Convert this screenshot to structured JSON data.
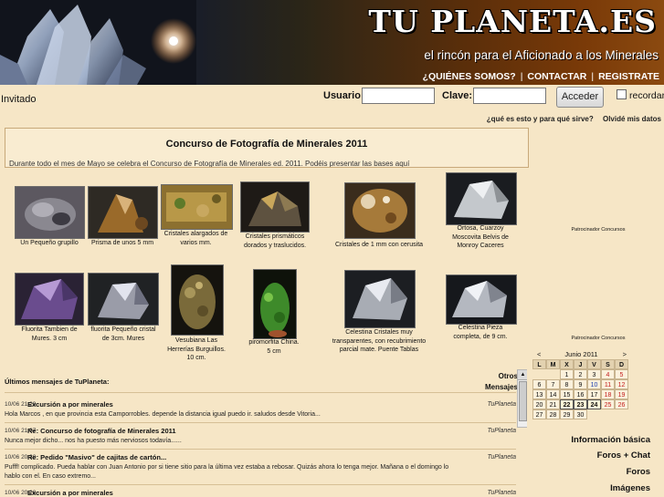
{
  "header": {
    "site_title": "TU PLANETA.ES",
    "tagline": "el rincón para el Aficionado a los Minerales",
    "links": [
      "¿QUIÉNES SOMOS?",
      "CONTACTAR",
      "REGISTRATE"
    ]
  },
  "login": {
    "guest_label": "Invitado",
    "user_label": "Usuario:",
    "pass_label": "Clave:",
    "submit_label": "Acceder",
    "remember_label": "recordar",
    "help_link": "¿qué es esto y para qué sirve?",
    "forgot_link": "Olvidé mis datos"
  },
  "contest": {
    "title": "Concurso de Fotografía de Minerales 2011",
    "text": "Durante todo el mes de Mayo se celebra el Concurso de Fotografía de Minerales ed. 2011. Podéis presentar las bases aquí"
  },
  "gallery": {
    "row1": [
      {
        "caption": "Un Pequeño grupillo"
      },
      {
        "caption": "Prisma de unos 5 mm"
      },
      {
        "caption": "Cristales alargados de varios mm."
      },
      {
        "caption": "Cristales prismáticos dorados y traslucidos."
      },
      {
        "caption": "Cristales de 1 mm con cerusita"
      },
      {
        "caption": "Ortosa, Cuarzoy Moscovita Belvis de Monroy Caceres"
      }
    ],
    "row2": [
      {
        "caption": "Fluorita Tambien de Mures. 3 cm"
      },
      {
        "caption": "fluorita Pequeño cristal de 3cm. Mures"
      },
      {
        "caption": "Vesubiana Las Herrerías Burguillos. 10 cm."
      },
      {
        "caption": "piromorfita China. 5 cm"
      },
      {
        "caption": "Celestina Cristales muy transparentes, con recubrimiento parcial mate. Puente Tablas"
      },
      {
        "caption": "Celestina Pieza completa, de 9 cm."
      }
    ],
    "sponsor_label": "Patrocinador Concursos"
  },
  "messages": {
    "header": "Últimos mensajes de TuPlaneta:",
    "other_label_1": "Otros",
    "other_label_2": "Mensajes",
    "items": [
      {
        "time": "10/06 21:29",
        "title": "Excursión a por minerales",
        "user": "TuPlaneta",
        "body": "Hola Marcos , en que provincia esta Camporrobles. depende la distancia igual puedo ir. saludos desde Vitoria..."
      },
      {
        "time": "10/06 21:07",
        "title": "Re: Concurso de fotografía de Minerales 2011",
        "user": "TuPlaneta",
        "body": "Nunca mejor dicho... nos ha puesto más nerviosos todavía......"
      },
      {
        "time": "10/06 20:30",
        "title": "Re: Pedido \"Masivo\" de cajitas de cartón...",
        "user": "TuPlaneta",
        "body": "Pufff! complicado. Pueda hablar con Juan Antonio por si tiene sitio para la última vez estaba a rebosar. Quizás ahora lo tenga mejor. Mañana o el domingo lo hablo con el. En caso extremo..."
      },
      {
        "time": "10/06 20:28",
        "title": "Excursión a por minerales",
        "user": "TuPlaneta",
        "body": ""
      }
    ]
  },
  "calendar": {
    "prev": "<",
    "next": ">",
    "month": "Junio 2011",
    "weekdays": [
      "L",
      "M",
      "X",
      "J",
      "V",
      "S",
      "D"
    ],
    "weeks": [
      [
        "",
        "",
        "1",
        "2",
        "3",
        "4",
        "5"
      ],
      [
        "6",
        "7",
        "8",
        "9",
        "10",
        "11",
        "12"
      ],
      [
        "13",
        "14",
        "15",
        "16",
        "17",
        "18",
        "19"
      ],
      [
        "20",
        "21",
        "22",
        "23",
        "24",
        "25",
        "26"
      ],
      [
        "27",
        "28",
        "29",
        "30",
        "",
        "",
        ""
      ]
    ],
    "today": "24"
  },
  "side_menu": [
    "Información básica",
    "Foros + Chat",
    "Foros",
    "Imágenes"
  ],
  "colors": {
    "page_bg": "#f6e6c6",
    "header_orange": "#8b4a10",
    "red_day": "#c42020",
    "blue_day": "#1f3fb0"
  }
}
